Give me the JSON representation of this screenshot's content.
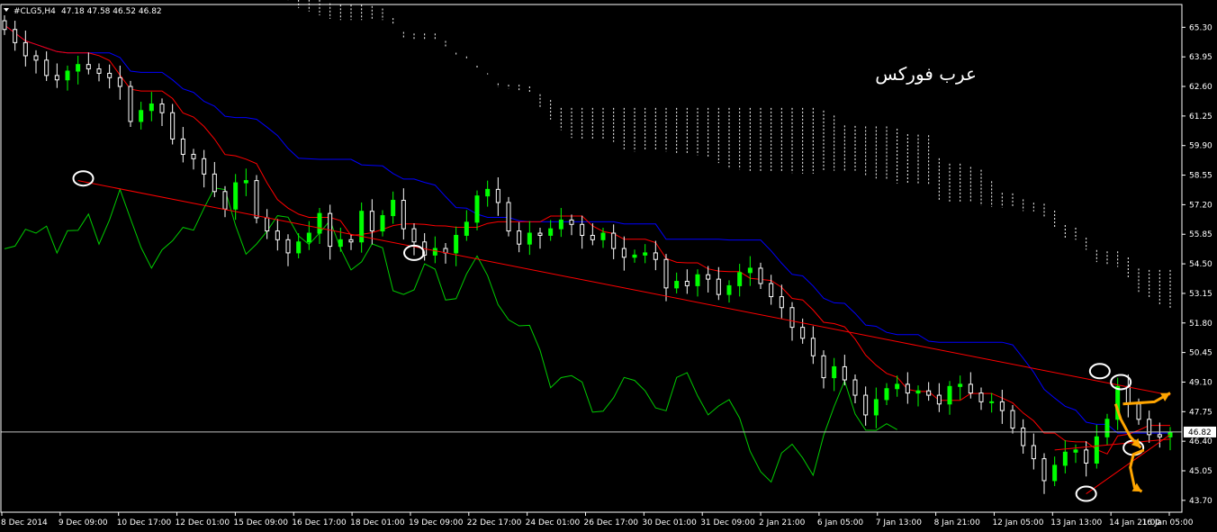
{
  "header": {
    "symbol_label": "#CLG5,H4",
    "ohlc": "47.18 47.58 46.52 46.82"
  },
  "watermark": "عرب فوركس",
  "colors": {
    "background": "#000000",
    "bull_candle": "#00ff00",
    "bear_candle": "#ffffff",
    "tenkan": "#ff0000",
    "kijun": "#0000ff",
    "chikou": "#00cc00",
    "cloud": "#ffffff",
    "trendline": "#ff0000",
    "arrow": "#ffa500",
    "price_line": "#c0c0c0"
  },
  "chart_data": {
    "type": "candlestick",
    "indicator": "ichimoku",
    "scale_shift_note": "",
    "current_price": 46.82,
    "ylim": [
      43.2,
      66.3
    ],
    "y_ticks": [
      65.3,
      63.95,
      62.6,
      61.25,
      59.9,
      58.55,
      57.2,
      55.85,
      54.5,
      53.15,
      51.8,
      50.45,
      49.1,
      47.75,
      46.4,
      45.05,
      43.7
    ],
    "x_ticks": [
      "8 Dec 2014",
      "9 Dec 09:00",
      "10 Dec 17:00",
      "12 Dec 01:00",
      "15 Dec 09:00",
      "16 Dec 17:00",
      "18 Dec 01:00",
      "19 Dec 09:00",
      "22 Dec 17:00",
      "24 Dec 01:00",
      "26 Dec 17:00",
      "30 Dec 01:00",
      "31 Dec 09:00",
      "2 Jan 21:00",
      "6 Jan 05:00",
      "7 Jan 13:00",
      "8 Jan 21:00",
      "12 Jan 05:00",
      "13 Jan 13:00",
      "14 Jan 21:00",
      "16 Jan 05:00"
    ],
    "close_series": [
      65.2,
      64.6,
      64.0,
      63.8,
      63.1,
      62.9,
      63.3,
      63.6,
      63.4,
      63.2,
      63.0,
      62.6,
      61.0,
      61.5,
      61.8,
      61.4,
      60.2,
      59.5,
      59.3,
      58.6,
      57.8,
      57.0,
      58.2,
      58.3,
      56.6,
      56.0,
      55.6,
      55.0,
      55.5,
      55.9,
      56.8,
      55.3,
      55.6,
      55.5,
      56.9,
      56.0,
      56.7,
      57.4,
      56.1,
      55.5,
      54.9,
      55.2,
      55.0,
      55.8,
      56.4,
      57.6,
      57.9,
      57.3,
      56.0,
      55.4,
      55.9,
      55.8,
      56.1,
      56.5,
      56.3,
      55.8,
      55.6,
      55.9,
      55.2,
      54.8,
      54.9,
      55.0,
      54.7,
      53.4,
      53.7,
      53.5,
      54.0,
      53.8,
      53.1,
      53.5,
      54.1,
      54.3,
      53.6,
      53.0,
      52.5,
      51.6,
      51.1,
      50.3,
      49.3,
      49.8,
      49.2,
      48.5,
      47.6,
      48.3,
      48.8,
      49.0,
      48.6,
      48.7,
      48.5,
      48.1,
      48.9,
      49.0,
      48.6,
      48.2,
      48.2,
      47.8,
      47.0,
      46.2,
      45.6,
      44.6,
      45.3,
      45.9,
      46.0,
      45.4,
      46.6,
      47.4,
      48.9,
      48.1,
      47.4,
      46.7,
      46.6,
      46.8
    ],
    "trendlines": [
      {
        "from": [
          7,
          58.3
        ],
        "to": [
          111,
          48.5
        ]
      },
      {
        "from": [
          103,
          44.0
        ],
        "to": [
          111,
          46.7
        ]
      },
      {
        "from": [
          100,
          46.0
        ],
        "to": [
          111,
          46.5
        ]
      }
    ],
    "price_line": 46.82,
    "circles": [
      {
        "x": 7.5,
        "y": 58.4
      },
      {
        "x": 39,
        "y": 55.0
      },
      {
        "x": 103,
        "y": 44.0
      },
      {
        "x": 104.3,
        "y": 49.6
      },
      {
        "x": 106.3,
        "y": 49.1
      },
      {
        "x": 107.5,
        "y": 46.1
      }
    ],
    "arrows": [
      {
        "points": [
          [
            105.8,
            48.1
          ],
          [
            106.3,
            47.4
          ],
          [
            107.2,
            46.6
          ],
          [
            108.2,
            46.1
          ]
        ]
      },
      {
        "points": [
          [
            106.5,
            48.1
          ],
          [
            109.5,
            48.2
          ],
          [
            111,
            48.6
          ]
        ]
      },
      {
        "points": [
          [
            108.5,
            46.0
          ],
          [
            107.5,
            45.8
          ],
          [
            107.2,
            45.2
          ],
          [
            107.6,
            44.3
          ],
          [
            108.3,
            44.1
          ]
        ]
      }
    ]
  }
}
